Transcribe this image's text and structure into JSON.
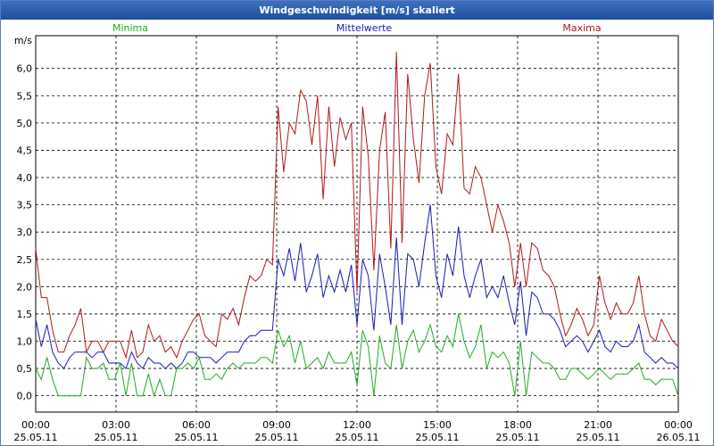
{
  "title": "Windgeschwindigkeit [m/s] skaliert",
  "legend": {
    "minima": "Minima",
    "mittelwerte": "Mittelwerte",
    "maxima": "Maxima"
  },
  "colors": {
    "minima": "#22aa22",
    "mittelwerte": "#1a1ab4",
    "maxima": "#b01818",
    "titlebar": "#2a5aae"
  },
  "chart_data": {
    "type": "line",
    "ylabel": "m/s",
    "ylim": [
      -0.3,
      6.6
    ],
    "yticks": [
      "0,0",
      "0,5",
      "1,0",
      "1,5",
      "2,0",
      "2,5",
      "3,0",
      "3,5",
      "4,0",
      "4,5",
      "5,0",
      "5,5",
      "6,0"
    ],
    "xticks": [
      {
        "time": "00:00",
        "date": "25.05.11"
      },
      {
        "time": "03:00",
        "date": "25.05.11"
      },
      {
        "time": "06:00",
        "date": "25.05.11"
      },
      {
        "time": "09:00",
        "date": "25.05.11"
      },
      {
        "time": "12:00",
        "date": "25.05.11"
      },
      {
        "time": "15:00",
        "date": "25.05.11"
      },
      {
        "time": "18:00",
        "date": "25.05.11"
      },
      {
        "time": "21:00",
        "date": "25.05.11"
      },
      {
        "time": "00:00",
        "date": "26.05.11"
      }
    ],
    "x_hours": [
      0,
      24
    ],
    "grid": true,
    "series": [
      {
        "name": "Maxima",
        "values": [
          2.7,
          1.8,
          1.8,
          1.2,
          0.8,
          0.8,
          1.1,
          1.3,
          1.6,
          0.8,
          1.0,
          1.0,
          0.8,
          1.0,
          1.0,
          1.0,
          0.7,
          1.2,
          0.7,
          0.8,
          1.3,
          1.0,
          1.1,
          0.8,
          0.9,
          0.7,
          1.0,
          1.2,
          1.4,
          1.5,
          1.1,
          1.0,
          0.9,
          1.5,
          1.4,
          1.6,
          1.3,
          1.8,
          2.2,
          2.1,
          2.2,
          2.5,
          2.4,
          5.3,
          4.1,
          5.0,
          4.8,
          5.6,
          5.4,
          4.6,
          5.5,
          3.6,
          5.3,
          4.2,
          5.1,
          4.7,
          5.0,
          1.9,
          5.3,
          4.4,
          2.3,
          4.5,
          5.2,
          2.7,
          6.3,
          2.8,
          5.9,
          4.7,
          3.9,
          5.5,
          6.1,
          4.2,
          3.7,
          4.8,
          4.6,
          5.9,
          3.8,
          3.7,
          4.2,
          4.0,
          3.5,
          3.0,
          3.5,
          3.2,
          2.8,
          2.0,
          2.8,
          2.0,
          2.8,
          2.7,
          2.3,
          2.2,
          2.0,
          1.5,
          1.1,
          1.3,
          1.6,
          1.4,
          1.1,
          1.3,
          2.2,
          1.7,
          1.4,
          1.7,
          1.5,
          1.5,
          1.7,
          2.2,
          1.5,
          1.1,
          1.0,
          1.4,
          1.2,
          1.0,
          0.9
        ]
      },
      {
        "name": "Mittelwerte",
        "values": [
          1.4,
          0.9,
          1.3,
          0.8,
          0.6,
          0.5,
          0.7,
          0.8,
          0.8,
          0.8,
          0.7,
          0.8,
          0.8,
          0.6,
          0.6,
          0.6,
          0.5,
          0.8,
          0.6,
          0.5,
          0.7,
          0.6,
          0.6,
          0.5,
          0.6,
          0.5,
          0.6,
          0.8,
          0.8,
          0.7,
          0.7,
          0.7,
          0.6,
          0.7,
          0.8,
          0.8,
          0.8,
          1.0,
          1.1,
          1.1,
          1.2,
          1.2,
          1.2,
          2.5,
          2.2,
          2.7,
          2.1,
          2.8,
          1.9,
          2.2,
          2.6,
          1.8,
          2.2,
          1.9,
          2.3,
          1.9,
          2.4,
          1.3,
          2.5,
          2.2,
          1.2,
          2.6,
          2.0,
          1.3,
          2.9,
          1.3,
          2.6,
          2.5,
          2.0,
          2.8,
          3.5,
          2.2,
          1.8,
          2.6,
          2.2,
          3.1,
          2.2,
          1.8,
          2.2,
          2.5,
          1.8,
          2.0,
          1.8,
          2.2,
          1.7,
          1.3,
          2.1,
          1.1,
          1.9,
          1.8,
          1.5,
          1.5,
          1.4,
          1.2,
          0.9,
          1.0,
          1.1,
          1.0,
          0.8,
          1.0,
          1.2,
          0.9,
          0.8,
          1.0,
          0.9,
          0.9,
          1.0,
          1.3,
          0.8,
          0.7,
          0.6,
          0.7,
          0.6,
          0.6,
          0.5
        ]
      },
      {
        "name": "Minima",
        "values": [
          0.5,
          0.3,
          0.7,
          0.3,
          0.0,
          0.0,
          0.0,
          0.0,
          0.0,
          0.7,
          0.5,
          0.5,
          0.6,
          0.3,
          0.3,
          0.6,
          0.0,
          0.6,
          0.0,
          0.0,
          0.4,
          0.0,
          0.3,
          0.0,
          0.0,
          0.5,
          0.5,
          0.6,
          0.5,
          0.7,
          0.3,
          0.3,
          0.4,
          0.3,
          0.5,
          0.6,
          0.5,
          0.6,
          0.6,
          0.6,
          0.7,
          0.7,
          0.6,
          1.2,
          0.9,
          1.1,
          0.6,
          1.0,
          0.5,
          0.6,
          0.7,
          0.5,
          0.8,
          0.6,
          0.6,
          0.6,
          0.8,
          0.2,
          1.2,
          0.9,
          0.0,
          1.1,
          0.6,
          0.5,
          1.3,
          0.5,
          1.0,
          1.2,
          0.8,
          1.0,
          1.3,
          0.9,
          0.8,
          1.1,
          0.9,
          1.5,
          1.0,
          0.7,
          0.9,
          1.3,
          0.5,
          0.8,
          0.7,
          0.8,
          0.6,
          0.0,
          1.0,
          0.0,
          0.8,
          0.7,
          0.6,
          0.6,
          0.5,
          0.3,
          0.3,
          0.5,
          0.5,
          0.4,
          0.3,
          0.4,
          0.5,
          0.4,
          0.3,
          0.4,
          0.4,
          0.4,
          0.5,
          0.6,
          0.3,
          0.3,
          0.2,
          0.3,
          0.3,
          0.3,
          0.0
        ]
      }
    ]
  }
}
